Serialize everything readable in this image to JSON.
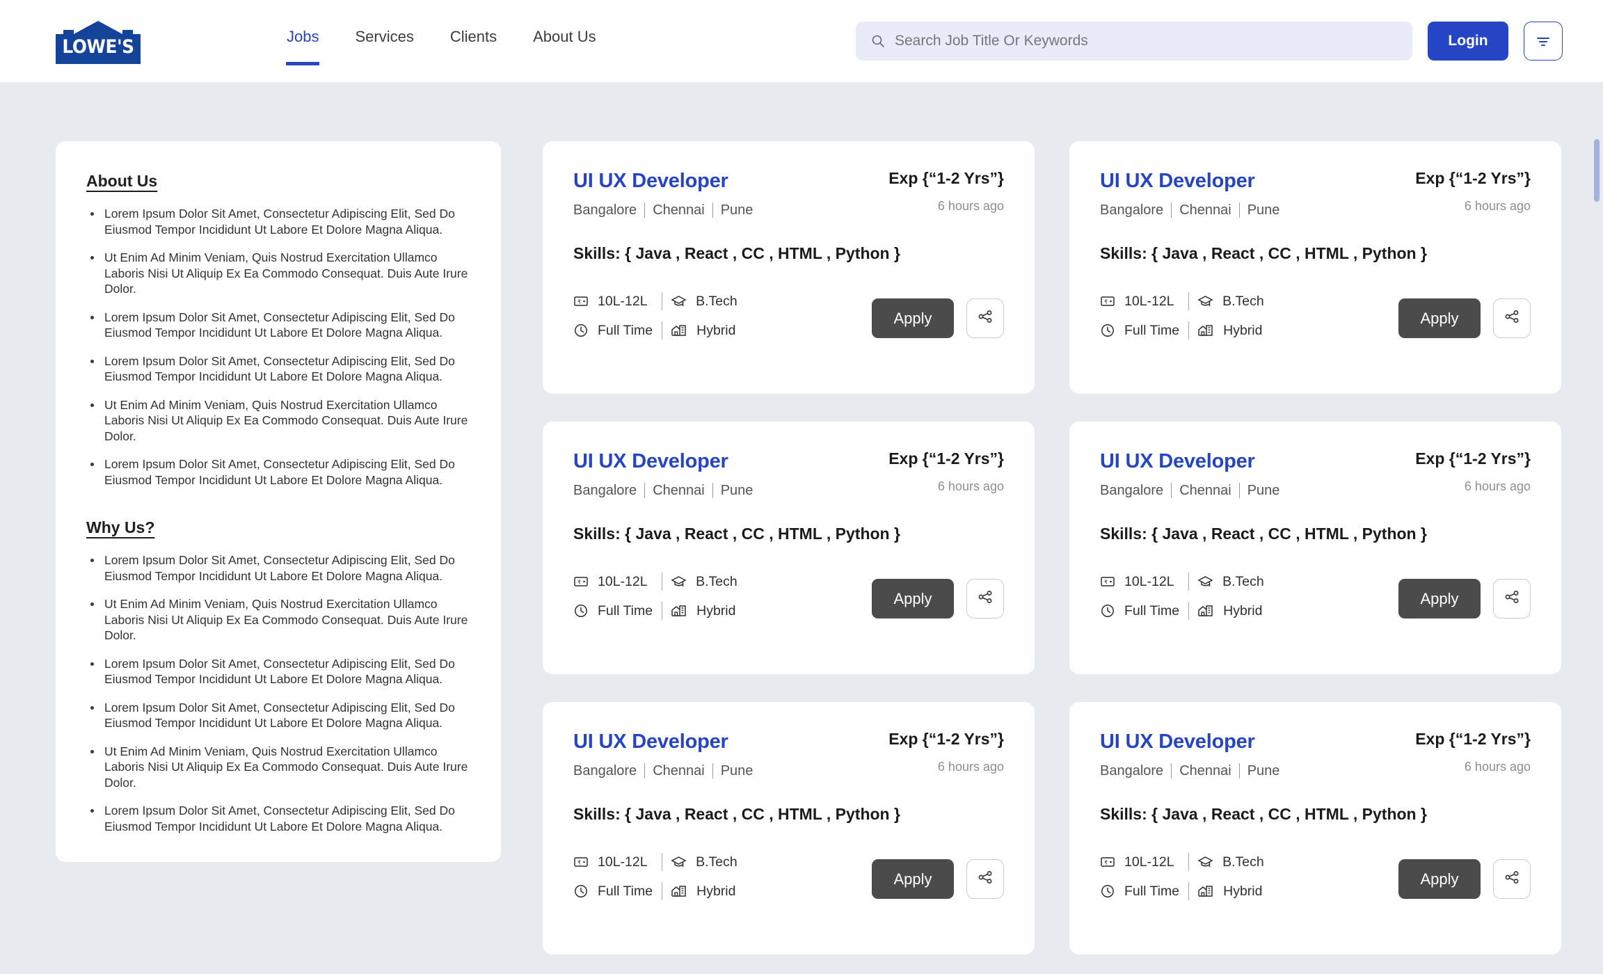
{
  "brand": {
    "logo_text": "LOWE'S",
    "logo_color": "#14439a",
    "accent_color": "#2645c4"
  },
  "nav": {
    "items": [
      {
        "label": "Jobs",
        "active": true
      },
      {
        "label": "Services",
        "active": false
      },
      {
        "label": "Clients",
        "active": false
      },
      {
        "label": "About Us",
        "active": false
      }
    ]
  },
  "search": {
    "placeholder": "Search Job Title Or Keywords",
    "value": "",
    "icon": "search-icon"
  },
  "header_actions": {
    "login_label": "Login",
    "filter_icon": "filter-icon"
  },
  "sidebar": {
    "sections": [
      {
        "heading": "About Us",
        "items": [
          "Lorem Ipsum Dolor Sit Amet, Consectetur Adipiscing Elit, Sed Do Eiusmod Tempor Incididunt Ut Labore Et Dolore Magna Aliqua.",
          "Ut Enim Ad Minim Veniam, Quis Nostrud Exercitation Ullamco Laboris Nisi Ut Aliquip Ex Ea Commodo Consequat. Duis Aute Irure Dolor.",
          "Lorem Ipsum Dolor Sit Amet, Consectetur Adipiscing Elit, Sed Do Eiusmod Tempor Incididunt Ut Labore Et Dolore Magna Aliqua.",
          "Lorem Ipsum Dolor Sit Amet, Consectetur Adipiscing Elit, Sed Do Eiusmod Tempor Incididunt Ut Labore Et Dolore Magna Aliqua.",
          "Ut Enim Ad Minim Veniam, Quis Nostrud Exercitation Ullamco Laboris Nisi Ut Aliquip Ex Ea Commodo Consequat. Duis Aute Irure Dolor.",
          "Lorem Ipsum Dolor Sit Amet, Consectetur Adipiscing Elit, Sed Do Eiusmod Tempor Incididunt Ut Labore Et Dolore Magna Aliqua."
        ]
      },
      {
        "heading": "Why Us?",
        "items": [
          "Lorem Ipsum Dolor Sit Amet, Consectetur Adipiscing Elit, Sed Do Eiusmod Tempor Incididunt Ut Labore Et Dolore Magna Aliqua.",
          "Ut Enim Ad Minim Veniam, Quis Nostrud Exercitation Ullamco Laboris Nisi Ut Aliquip Ex Ea Commodo Consequat. Duis Aute Irure Dolor.",
          "Lorem Ipsum Dolor Sit Amet, Consectetur Adipiscing Elit, Sed Do Eiusmod Tempor Incididunt Ut Labore Et Dolore Magna Aliqua.",
          "Lorem Ipsum Dolor Sit Amet, Consectetur Adipiscing Elit, Sed Do Eiusmod Tempor Incididunt Ut Labore Et Dolore Magna Aliqua.",
          "Ut Enim Ad Minim Veniam, Quis Nostrud Exercitation Ullamco Laboris Nisi Ut Aliquip Ex Ea Commodo Consequat. Duis Aute Irure Dolor.",
          "Lorem Ipsum Dolor Sit Amet, Consectetur Adipiscing Elit, Sed Do Eiusmod Tempor Incididunt Ut Labore Et Dolore Magna Aliqua."
        ]
      }
    ]
  },
  "jobs": {
    "labels": {
      "apply": "Apply",
      "share_icon": "share-icon",
      "salary_icon": "rupee-note-icon",
      "degree_icon": "graduation-cap-icon",
      "jobtype_icon": "clock-icon",
      "workmode_icon": "home-office-icon"
    },
    "cards": [
      {
        "title": "UI UX Developer",
        "locations": [
          "Bangalore",
          "Chennai",
          "Pune"
        ],
        "experience": "Exp {“1-2 Yrs”}",
        "posted": "6 hours ago",
        "skills": "Skills: { Java , React , CC , HTML , Python }",
        "salary": "10L-12L",
        "degree": "B.Tech",
        "job_type": "Full Time",
        "work_mode": "Hybrid"
      },
      {
        "title": "UI UX Developer",
        "locations": [
          "Bangalore",
          "Chennai",
          "Pune"
        ],
        "experience": "Exp {“1-2 Yrs”}",
        "posted": "6 hours ago",
        "skills": "Skills: { Java , React , CC , HTML , Python }",
        "salary": "10L-12L",
        "degree": "B.Tech",
        "job_type": "Full Time",
        "work_mode": "Hybrid"
      },
      {
        "title": "UI UX Developer",
        "locations": [
          "Bangalore",
          "Chennai",
          "Pune"
        ],
        "experience": "Exp {“1-2 Yrs”}",
        "posted": "6 hours ago",
        "skills": "Skills: { Java , React , CC , HTML , Python }",
        "salary": "10L-12L",
        "degree": "B.Tech",
        "job_type": "Full Time",
        "work_mode": "Hybrid"
      },
      {
        "title": "UI UX Developer",
        "locations": [
          "Bangalore",
          "Chennai",
          "Pune"
        ],
        "experience": "Exp {“1-2 Yrs”}",
        "posted": "6 hours ago",
        "skills": "Skills: { Java , React , CC , HTML , Python }",
        "salary": "10L-12L",
        "degree": "B.Tech",
        "job_type": "Full Time",
        "work_mode": "Hybrid"
      },
      {
        "title": "UI UX Developer",
        "locations": [
          "Bangalore",
          "Chennai",
          "Pune"
        ],
        "experience": "Exp {“1-2 Yrs”}",
        "posted": "6 hours ago",
        "skills": "Skills: { Java , React , CC , HTML , Python }",
        "salary": "10L-12L",
        "degree": "B.Tech",
        "job_type": "Full Time",
        "work_mode": "Hybrid"
      },
      {
        "title": "UI UX Developer",
        "locations": [
          "Bangalore",
          "Chennai",
          "Pune"
        ],
        "experience": "Exp {“1-2 Yrs”}",
        "posted": "6 hours ago",
        "skills": "Skills: { Java , React , CC , HTML , Python }",
        "salary": "10L-12L",
        "degree": "B.Tech",
        "job_type": "Full Time",
        "work_mode": "Hybrid"
      }
    ]
  },
  "scrollbar": {
    "thumb_color": "#a3b0e0"
  }
}
